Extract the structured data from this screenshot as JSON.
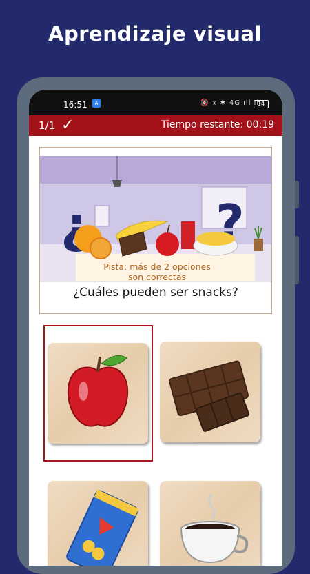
{
  "headline": "Aprendizaje visual",
  "status_bar": {
    "time": "16:51",
    "notification_badge": "A",
    "icons": "🔇 ⚹ ✱ 4G ıll ıll",
    "battery": "14"
  },
  "quiz_bar": {
    "progress": "1/1",
    "check_icon": "checkmark-icon",
    "timer_label": "Tiempo restante:",
    "timer_value": "00:19"
  },
  "question_card": {
    "hint_line1": "Pista: más de 2 opciones",
    "hint_line2": "son correctas",
    "question": "¿Cuáles pueden ser snacks?"
  },
  "options": [
    {
      "name": "apple",
      "selected": true
    },
    {
      "name": "chocolate",
      "selected": false
    },
    {
      "name": "chips",
      "selected": false
    },
    {
      "name": "coffee",
      "selected": false
    }
  ],
  "colors": {
    "background": "#232a6b",
    "accent_red": "#a41219",
    "phone_frame": "#5d6c7c",
    "hint_text": "#b0651d"
  }
}
